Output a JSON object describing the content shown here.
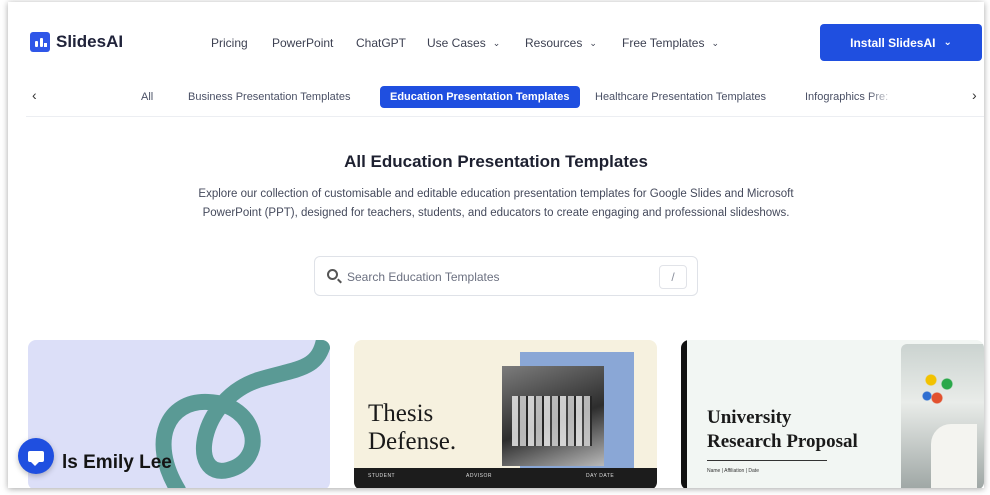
{
  "brand": {
    "name": "SlidesAI",
    "color": "#1f4fe0"
  },
  "nav": {
    "items": [
      {
        "label": "Pricing",
        "dropdown": false
      },
      {
        "label": "PowerPoint",
        "dropdown": false
      },
      {
        "label": "ChatGPT",
        "dropdown": false
      },
      {
        "label": "Use Cases",
        "dropdown": true
      },
      {
        "label": "Resources",
        "dropdown": true
      },
      {
        "label": "Free Templates",
        "dropdown": true
      }
    ],
    "install_label": "Install SlidesAI"
  },
  "categories": {
    "items": [
      "All",
      "Business Presentation Templates",
      "Education Presentation Templates",
      "Healthcare Presentation Templates",
      "Infographics Pre:"
    ],
    "active": "Education Presentation Templates",
    "prev_icon": "chevron-left-icon",
    "next_icon": "chevron-right-icon"
  },
  "hero": {
    "title": "All Education Presentation Templates",
    "description": "Explore our collection of customisable and editable education presentation templates for Google Slides and Microsoft PowerPoint (PPT), designed for teachers, students, and educators to create engaging and professional slideshows."
  },
  "search": {
    "placeholder": "Search Education Templates",
    "shortcut": "/",
    "icon": "search-icon"
  },
  "cards": [
    {
      "title": "ls Emily Lee",
      "accent": "#5a9a95",
      "background": "#dcdff8"
    },
    {
      "title_line1": "Thesis",
      "title_line2": "Defense.",
      "footer": [
        "STUDENT",
        "ADVISOR",
        "DAY DATE"
      ],
      "background": "#f6f1df"
    },
    {
      "title_line1": "University",
      "title_line2": "Research Proposal",
      "meta": "Name | Affiliation | Date",
      "background": "#f2f6f3"
    }
  ],
  "chat_widget": {
    "icon": "chat-icon"
  }
}
